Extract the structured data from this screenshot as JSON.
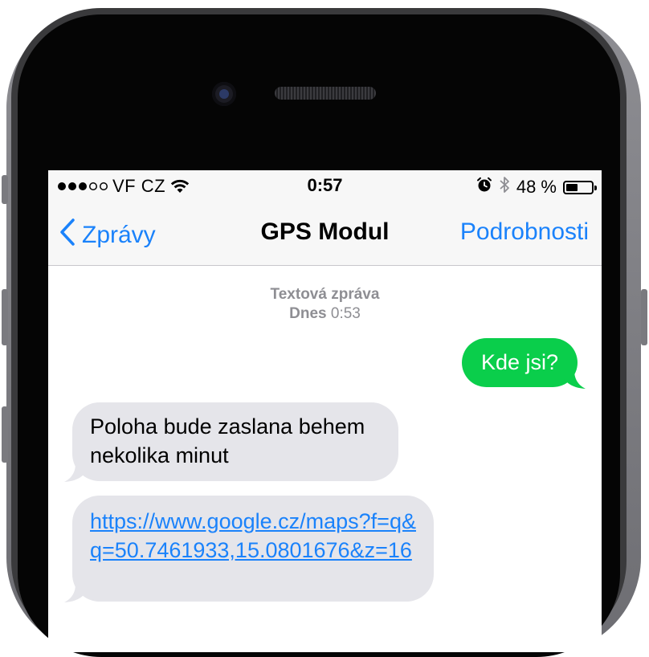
{
  "status_bar": {
    "carrier": "VF CZ",
    "time": "0:57",
    "battery_percent": "48 %",
    "battery_level": 0.48,
    "signal_strength_dots": 3,
    "signal_total_dots": 5,
    "icons": [
      "wifi-icon",
      "alarm-icon",
      "bluetooth-icon",
      "battery-icon"
    ]
  },
  "nav": {
    "back_label": "Zprávy",
    "title": "GPS Modul",
    "details_label": "Podrobnosti"
  },
  "conversation": {
    "header_type": "Textová zpráva",
    "header_day": "Dnes",
    "header_time": "0:53",
    "messages": [
      {
        "direction": "outgoing",
        "text": "Kde jsi?"
      },
      {
        "direction": "incoming",
        "text": "Poloha bude zaslana behem nekolika minut"
      },
      {
        "direction": "incoming",
        "text": "https://www.google.cz/maps?f=q&q=50.7461933,15.0801676&z=16",
        "is_link": true
      }
    ]
  },
  "colors": {
    "ios_blue": "#1a82fb",
    "sms_green": "#0ace4b",
    "incoming_gray": "#e5e5ea",
    "meta_gray": "#8e8e93"
  }
}
